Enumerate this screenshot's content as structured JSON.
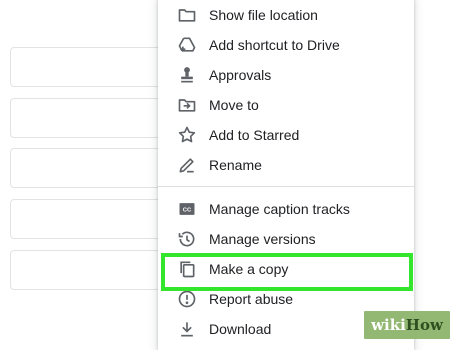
{
  "menu": {
    "group1": [
      {
        "label": "Show file location",
        "icon": "folder-icon"
      },
      {
        "label": "Add shortcut to Drive",
        "icon": "add-to-drive-icon"
      },
      {
        "label": "Approvals",
        "icon": "approvals-stamp-icon"
      },
      {
        "label": "Move to",
        "icon": "move-to-folder-icon"
      },
      {
        "label": "Add to Starred",
        "icon": "star-icon"
      },
      {
        "label": "Rename",
        "icon": "pencil-icon"
      }
    ],
    "group2": [
      {
        "label": "Manage caption tracks",
        "icon": "closed-caption-icon"
      },
      {
        "label": "Manage versions",
        "icon": "history-icon"
      },
      {
        "label": "Make a copy",
        "icon": "copy-icon",
        "highlighted": true
      },
      {
        "label": "Report abuse",
        "icon": "report-icon"
      },
      {
        "label": "Download",
        "icon": "download-icon"
      }
    ]
  },
  "colors": {
    "highlight": "#33e62c",
    "icon": "#5f6368",
    "text": "#202124",
    "watermark_bg": "#93b874"
  },
  "watermark": {
    "wiki": "wiki",
    "how": "How"
  }
}
